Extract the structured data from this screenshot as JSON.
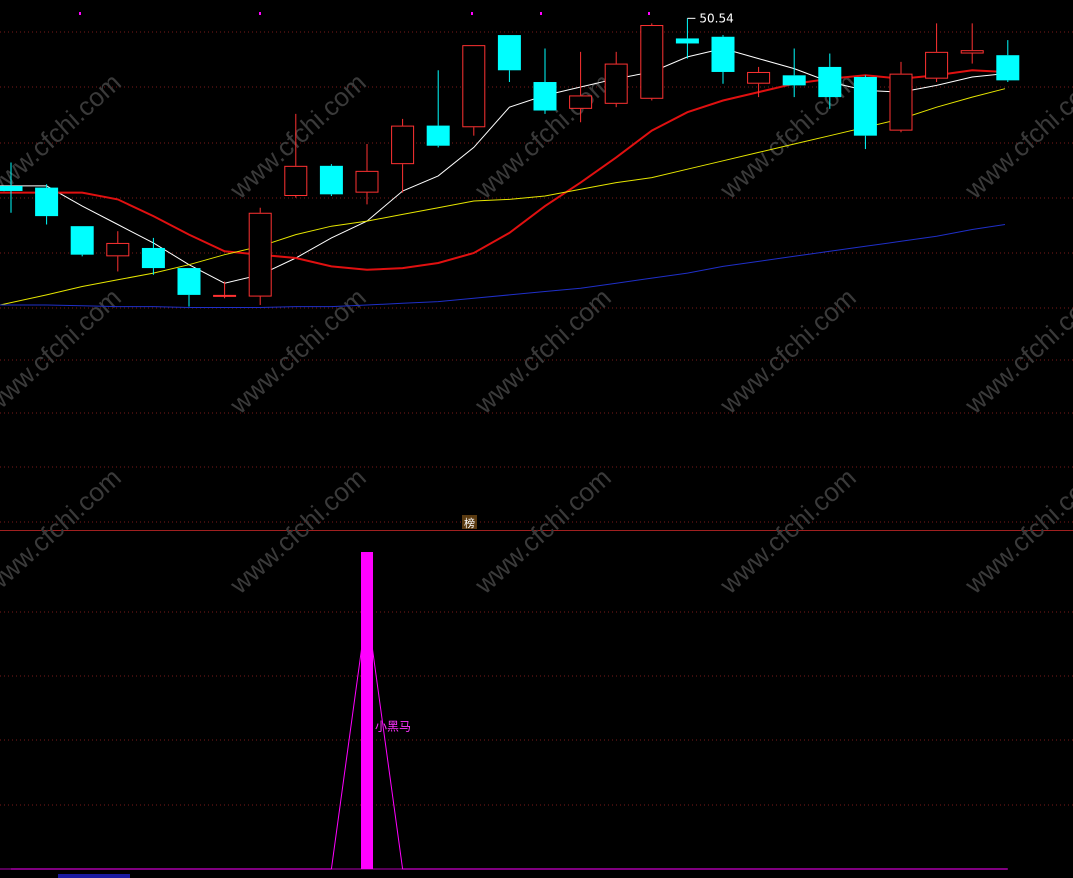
{
  "chart_data": [
    {
      "type": "candlestick",
      "panel": "price",
      "ylim": [
        30.5,
        51.5
      ],
      "candles": [
        {
          "open": 41.6,
          "close": 41.3,
          "high": 43.0,
          "low": 40.0
        },
        {
          "open": 41.5,
          "close": 39.8,
          "high": 41.7,
          "low": 39.3
        },
        {
          "open": 39.2,
          "close": 37.5,
          "high": 39.2,
          "low": 37.4
        },
        {
          "open": 37.4,
          "close": 38.2,
          "high": 38.9,
          "low": 36.5
        },
        {
          "open": 37.9,
          "close": 36.7,
          "high": 38.5,
          "low": 36.3
        },
        {
          "open": 36.7,
          "close": 35.1,
          "high": 36.7,
          "low": 34.4
        },
        {
          "open": 35.0,
          "close": 35.1,
          "high": 35.9,
          "low": 34.9
        },
        {
          "open": 35.0,
          "close": 40.0,
          "high": 40.3,
          "low": 34.5
        },
        {
          "open": 41.0,
          "close": 42.8,
          "high": 45.9,
          "low": 40.9
        },
        {
          "open": 42.8,
          "close": 41.1,
          "high": 42.9,
          "low": 41.0
        },
        {
          "open": 41.2,
          "close": 42.5,
          "high": 44.1,
          "low": 40.5
        },
        {
          "open": 42.9,
          "close": 45.2,
          "high": 45.6,
          "low": 41.2
        },
        {
          "open": 45.2,
          "close": 44.0,
          "high": 48.5,
          "low": 43.9
        },
        {
          "open": 45.1,
          "close": 50.0,
          "high": 50.0,
          "low": 44.6
        },
        {
          "open": 50.6,
          "close": 48.5,
          "high": 50.6,
          "low": 47.8
        },
        {
          "open": 47.8,
          "close": 46.1,
          "high": 49.8,
          "low": 45.9
        },
        {
          "open": 46.2,
          "close": 47.0,
          "high": 49.6,
          "low": 45.4
        },
        {
          "open": 46.5,
          "close": 48.9,
          "high": 49.6,
          "low": 46.3
        },
        {
          "open": 46.8,
          "close": 51.2,
          "high": 51.3,
          "low": 46.7
        },
        {
          "open": 50.4,
          "close": 50.1,
          "high": 51.6,
          "low": 49.2
        },
        {
          "open": 50.5,
          "close": 48.4,
          "high": 50.6,
          "low": 47.7
        },
        {
          "open": 47.7,
          "close": 48.4,
          "high": 48.7,
          "low": 46.9
        },
        {
          "open": 48.2,
          "close": 47.6,
          "high": 49.8,
          "low": 46.9
        },
        {
          "open": 48.7,
          "close": 46.9,
          "high": 49.5,
          "low": 46.2
        },
        {
          "open": 48.1,
          "close": 44.6,
          "high": 48.2,
          "low": 43.8
        },
        {
          "open": 44.9,
          "close": 48.3,
          "high": 49.0,
          "low": 44.8
        },
        {
          "open": 48.0,
          "close": 49.6,
          "high": 51.3,
          "low": 47.8
        },
        {
          "open": 49.5,
          "close": 49.7,
          "high": 51.3,
          "low": 48.9
        },
        {
          "open": 49.4,
          "close": 47.9,
          "high": 50.3,
          "low": 47.8
        }
      ],
      "bull_color": "#ff3232",
      "bear_color": "#00ffff",
      "high_label": {
        "text": "50.54",
        "candle_index": 19
      },
      "series": [
        {
          "color": "#ffffff",
          "width": 1,
          "values": [
            41.6,
            41.6,
            40.4,
            39.3,
            38.2,
            36.9,
            35.8,
            36.3,
            37.3,
            38.5,
            39.5,
            41.3,
            42.2,
            43.9,
            46.3,
            47.0,
            47.5,
            48.0,
            48.4,
            49.3,
            49.8,
            49.2,
            48.6,
            47.8,
            47.3,
            47.2,
            47.6,
            48.1,
            48.3
          ]
        },
        {
          "color": "#e01010",
          "width": 2,
          "values": [
            41.2,
            41.2,
            41.2,
            40.8,
            39.8,
            38.7,
            37.7,
            37.5,
            37.3,
            36.8,
            36.6,
            36.7,
            37.0,
            37.6,
            38.8,
            40.4,
            41.8,
            43.3,
            44.9,
            46.0,
            46.7,
            47.2,
            47.7,
            48.0,
            48.2,
            48.0,
            48.2,
            48.5,
            48.4
          ]
        },
        {
          "color": "#e6e600",
          "width": 1,
          "values": [
            34.5,
            35.1,
            35.6,
            36.0,
            36.4,
            36.9,
            37.5,
            38.0,
            38.7,
            39.2,
            39.5,
            39.9,
            40.3,
            40.7,
            40.8,
            41.0,
            41.4,
            41.8,
            42.1,
            42.6,
            43.1,
            43.6,
            44.1,
            44.6,
            45.1,
            45.6,
            46.3,
            46.9,
            47.4
          ]
        },
        {
          "color": "#1f2fc8",
          "width": 1,
          "values": [
            34.5,
            34.5,
            34.45,
            34.4,
            34.4,
            34.35,
            34.35,
            34.35,
            34.4,
            34.4,
            34.5,
            34.6,
            34.7,
            34.9,
            35.1,
            35.3,
            35.5,
            35.8,
            36.1,
            36.4,
            36.8,
            37.1,
            37.4,
            37.7,
            38.0,
            38.3,
            38.6,
            39.0,
            39.3
          ]
        }
      ]
    },
    {
      "type": "bar",
      "panel": "indicator",
      "name": "小黑马",
      "ylim": [
        0,
        100
      ],
      "bar_index": 10,
      "bar_value": 100,
      "line_values": [
        0,
        0,
        0,
        0,
        0,
        0,
        0,
        0,
        0,
        0,
        82,
        0,
        0,
        0,
        0,
        0,
        0,
        0,
        0,
        0,
        0,
        0,
        0,
        0,
        0,
        0,
        0,
        0,
        0
      ],
      "bar_color": "#ff00ff",
      "line_color": "#ff00ff"
    }
  ],
  "panel_tag": "榜",
  "watermark": "www.cfchi.com",
  "colors": {
    "background": "#000000",
    "grid": "#7a1a1a",
    "divider": "#a02020"
  }
}
